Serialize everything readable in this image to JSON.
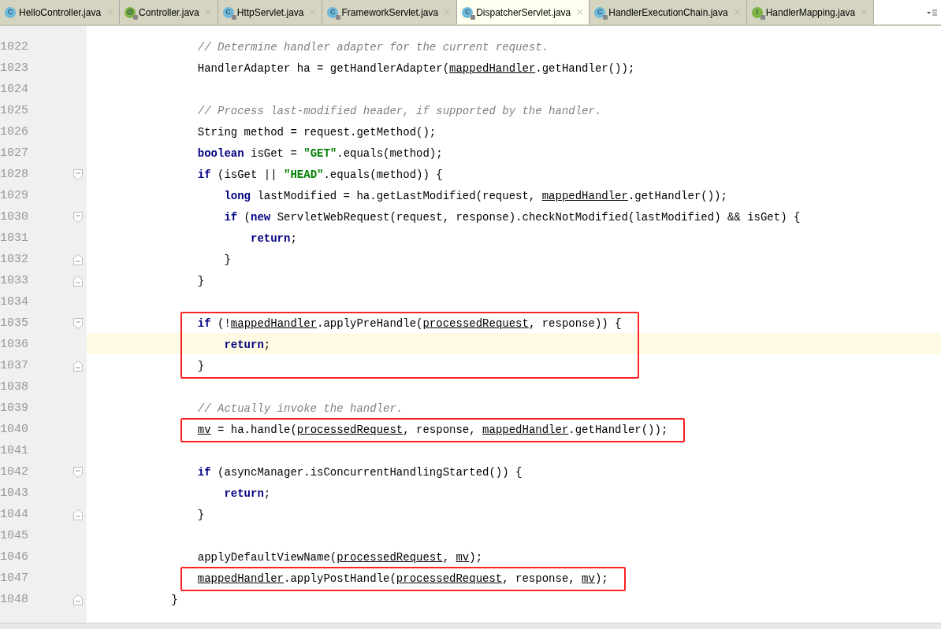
{
  "tabs": [
    {
      "label": "HelloController.java",
      "badge": "C",
      "kind": "class",
      "locked": false,
      "selected": false
    },
    {
      "label": "Controller.java",
      "badge": "@",
      "kind": "annotation",
      "locked": true,
      "selected": false
    },
    {
      "label": "HttpServlet.java",
      "badge": "C",
      "kind": "class",
      "locked": true,
      "selected": false
    },
    {
      "label": "FrameworkServlet.java",
      "badge": "C",
      "kind": "class",
      "locked": true,
      "selected": false
    },
    {
      "label": "DispatcherServlet.java",
      "badge": "C",
      "kind": "class",
      "locked": true,
      "selected": true
    },
    {
      "label": "HandlerExecutionChain.java",
      "badge": "C",
      "kind": "class",
      "locked": true,
      "selected": false
    },
    {
      "label": "HandlerMapping.java",
      "badge": "I",
      "kind": "interface",
      "locked": true,
      "selected": false
    }
  ],
  "lines": [
    {
      "number": "1022",
      "fold_start": false,
      "fold_end": false,
      "current": false,
      "boxed": false,
      "tokens": [
        {
          "kind": "comment",
          "text": "// Determine handler adapter for the current request."
        }
      ]
    },
    {
      "number": "1023",
      "fold_start": false,
      "fold_end": false,
      "current": false,
      "boxed": false,
      "tokens": [
        {
          "kind": "plain",
          "text": "HandlerAdapter ha = getHandlerAdapter("
        },
        {
          "kind": "field",
          "text": "mappedHandler"
        },
        {
          "kind": "plain",
          "text": ".getHandler());"
        }
      ]
    },
    {
      "number": "1024",
      "fold_start": false,
      "fold_end": false,
      "current": false,
      "boxed": false
    },
    {
      "number": "1025",
      "fold_start": false,
      "fold_end": false,
      "current": false,
      "boxed": false,
      "tokens": [
        {
          "kind": "comment",
          "text": "// Process last-modified header, if supported by the handler."
        }
      ]
    },
    {
      "number": "1026",
      "fold_start": false,
      "fold_end": false,
      "current": false,
      "boxed": false,
      "tokens": [
        {
          "kind": "plain",
          "text": "String method = request.getMethod();"
        }
      ]
    },
    {
      "number": "1027",
      "fold_start": false,
      "fold_end": false,
      "current": false,
      "boxed": false,
      "tokens": [
        {
          "kind": "keyword",
          "text": "boolean"
        },
        {
          "kind": "plain",
          "text": " isGet = "
        },
        {
          "kind": "string",
          "text": "\"GET\""
        },
        {
          "kind": "plain",
          "text": ".equals(method);"
        }
      ]
    },
    {
      "number": "1028",
      "fold_start": true,
      "fold_end": false,
      "current": false,
      "boxed": false,
      "tokens": [
        {
          "kind": "keyword",
          "text": "if"
        },
        {
          "kind": "plain",
          "text": " (isGet || "
        },
        {
          "kind": "string",
          "text": "\"HEAD\""
        },
        {
          "kind": "plain",
          "text": ".equals(method)) {"
        }
      ],
      "children": [
        {
          "number": "1029",
          "fold_start": false,
          "fold_end": false,
          "current": false,
          "boxed": false,
          "tokens": [
            {
              "kind": "keyword",
              "text": "long"
            },
            {
              "kind": "plain",
              "text": " lastModified = ha.getLastModified(request, "
            },
            {
              "kind": "field",
              "text": "mappedHandler"
            },
            {
              "kind": "plain",
              "text": ".getHandler());"
            }
          ]
        },
        {
          "number": "1030",
          "fold_start": true,
          "fold_end": false,
          "current": false,
          "boxed": false,
          "tokens": [
            {
              "kind": "keyword",
              "text": "if"
            },
            {
              "kind": "plain",
              "text": " ("
            },
            {
              "kind": "keyword",
              "text": "new"
            },
            {
              "kind": "plain",
              "text": " ServletWebRequest(request, response).checkNotModified(lastModified) && isGet) {"
            }
          ],
          "children": [
            {
              "number": "1031",
              "fold_start": false,
              "fold_end": false,
              "current": false,
              "boxed": false,
              "tokens": [
                {
                  "kind": "keyword",
                  "text": "return"
                },
                {
                  "kind": "plain",
                  "text": ";"
                }
              ]
            }
          ]
        },
        {
          "number": "1032",
          "fold_start": false,
          "fold_end": true,
          "current": false,
          "boxed": false,
          "tokens": [
            {
              "kind": "plain",
              "text": "}"
            }
          ]
        }
      ]
    },
    {
      "number": "1033",
      "fold_start": false,
      "fold_end": true,
      "current": false,
      "boxed": false,
      "tokens": [
        {
          "kind": "plain",
          "text": "}"
        }
      ]
    },
    {
      "number": "1034",
      "fold_start": false,
      "fold_end": false,
      "current": false,
      "boxed": false
    },
    {
      "number": "1035",
      "fold_start": true,
      "fold_end": false,
      "current": false,
      "boxed": true,
      "tokens": [
        {
          "kind": "keyword",
          "text": "if"
        },
        {
          "kind": "plain",
          "text": " (!"
        },
        {
          "kind": "field",
          "text": "mappedHandler"
        },
        {
          "kind": "plain",
          "text": ".applyPreHandle("
        },
        {
          "kind": "field",
          "text": "processedRequest"
        },
        {
          "kind": "plain",
          "text": ", response)) {"
        }
      ],
      "children": [
        {
          "number": "1036",
          "fold_start": false,
          "fold_end": false,
          "current": true,
          "boxed": true,
          "tokens": [
            {
              "kind": "keyword",
              "text": "return"
            },
            {
              "kind": "plain",
              "text": ";"
            }
          ]
        }
      ]
    },
    {
      "number": "1037",
      "fold_start": false,
      "fold_end": true,
      "current": false,
      "boxed": true,
      "tokens": [
        {
          "kind": "plain",
          "text": "}"
        }
      ]
    },
    {
      "number": "1038",
      "fold_start": false,
      "fold_end": false,
      "current": false,
      "boxed": false
    },
    {
      "number": "1039",
      "fold_start": false,
      "fold_end": false,
      "current": false,
      "boxed": false,
      "tokens": [
        {
          "kind": "comment",
          "text": "// Actually invoke the handler."
        }
      ]
    },
    {
      "number": "1040",
      "fold_start": false,
      "fold_end": false,
      "current": false,
      "boxed": true,
      "tokens": [
        {
          "kind": "field",
          "text": "mv"
        },
        {
          "kind": "plain",
          "text": " = ha.handle("
        },
        {
          "kind": "field",
          "text": "processedRequest"
        },
        {
          "kind": "plain",
          "text": ", response, "
        },
        {
          "kind": "field",
          "text": "mappedHandler"
        },
        {
          "kind": "plain",
          "text": ".getHandler());"
        }
      ]
    },
    {
      "number": "1041",
      "fold_start": false,
      "fold_end": false,
      "current": false,
      "boxed": false
    },
    {
      "number": "1042",
      "fold_start": true,
      "fold_end": false,
      "current": false,
      "boxed": false,
      "tokens": [
        {
          "kind": "keyword",
          "text": "if"
        },
        {
          "kind": "plain",
          "text": " (asyncManager.isConcurrentHandlingStarted()) {"
        }
      ],
      "children": [
        {
          "number": "1043",
          "fold_start": false,
          "fold_end": false,
          "current": false,
          "boxed": false,
          "tokens": [
            {
              "kind": "keyword",
              "text": "return"
            },
            {
              "kind": "plain",
              "text": ";"
            }
          ]
        }
      ]
    },
    {
      "number": "1044",
      "fold_start": false,
      "fold_end": true,
      "current": false,
      "boxed": false,
      "tokens": [
        {
          "kind": "plain",
          "text": "}"
        }
      ]
    },
    {
      "number": "1045",
      "fold_start": false,
      "fold_end": false,
      "current": false,
      "boxed": false
    },
    {
      "number": "1046",
      "fold_start": false,
      "fold_end": false,
      "current": false,
      "boxed": false,
      "tokens": [
        {
          "kind": "plain",
          "text": "applyDefaultViewName("
        },
        {
          "kind": "field",
          "text": "processedRequest"
        },
        {
          "kind": "plain",
          "text": ", "
        },
        {
          "kind": "field",
          "text": "mv"
        },
        {
          "kind": "plain",
          "text": ");"
        }
      ]
    },
    {
      "number": "1047",
      "fold_start": false,
      "fold_end": false,
      "current": false,
      "boxed": true,
      "tokens": [
        {
          "kind": "field",
          "text": "mappedHandler"
        },
        {
          "kind": "plain",
          "text": ".applyPostHandle("
        },
        {
          "kind": "field",
          "text": "processedRequest"
        },
        {
          "kind": "plain",
          "text": ", response, "
        },
        {
          "kind": "field",
          "text": "mv"
        },
        {
          "kind": "plain",
          "text": ");"
        }
      ]
    }
  ],
  "closing_line": {
    "number": "1048",
    "fold_start": false,
    "fold_end": true,
    "current": false,
    "boxed": false,
    "tokens": [
      {
        "kind": "plain",
        "text": "}"
      }
    ]
  }
}
